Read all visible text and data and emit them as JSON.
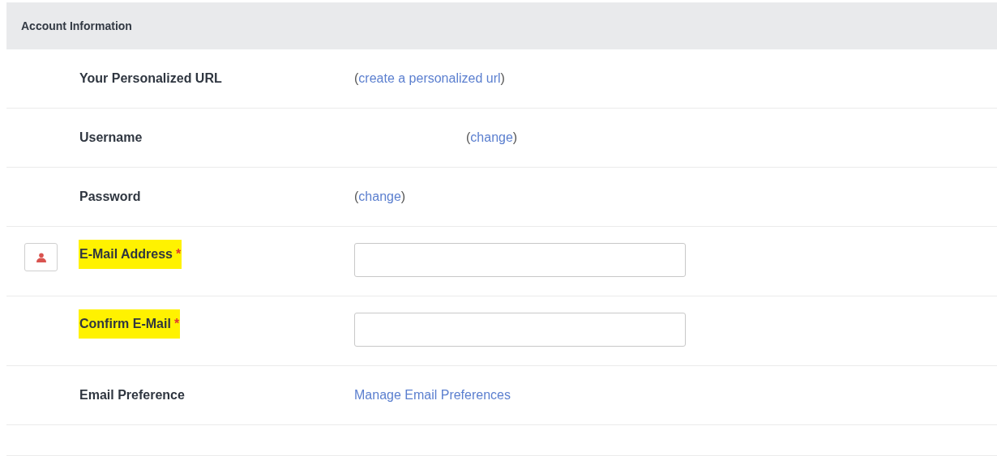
{
  "section": {
    "title": "Account Information"
  },
  "rows": [
    {
      "kind": "link",
      "label": "Your Personalized URL",
      "open": "(",
      "link": "create a personalized url",
      "close": ")"
    },
    {
      "kind": "indented_link",
      "label": "Username",
      "open": "(",
      "link": "change",
      "close": ")"
    },
    {
      "kind": "link",
      "label": "Password",
      "open": "(",
      "link": "change",
      "close": ")"
    },
    {
      "kind": "input",
      "label": "E-Mail Address",
      "required": "*",
      "highlighted": true,
      "user_icon": true
    },
    {
      "kind": "input",
      "label": "Confirm E-Mail",
      "required": "*",
      "highlighted": true,
      "user_icon": false
    },
    {
      "kind": "plain_link",
      "label": "Email Preference",
      "link": "Manage Email Preferences"
    },
    {
      "kind": "empty"
    }
  ]
}
